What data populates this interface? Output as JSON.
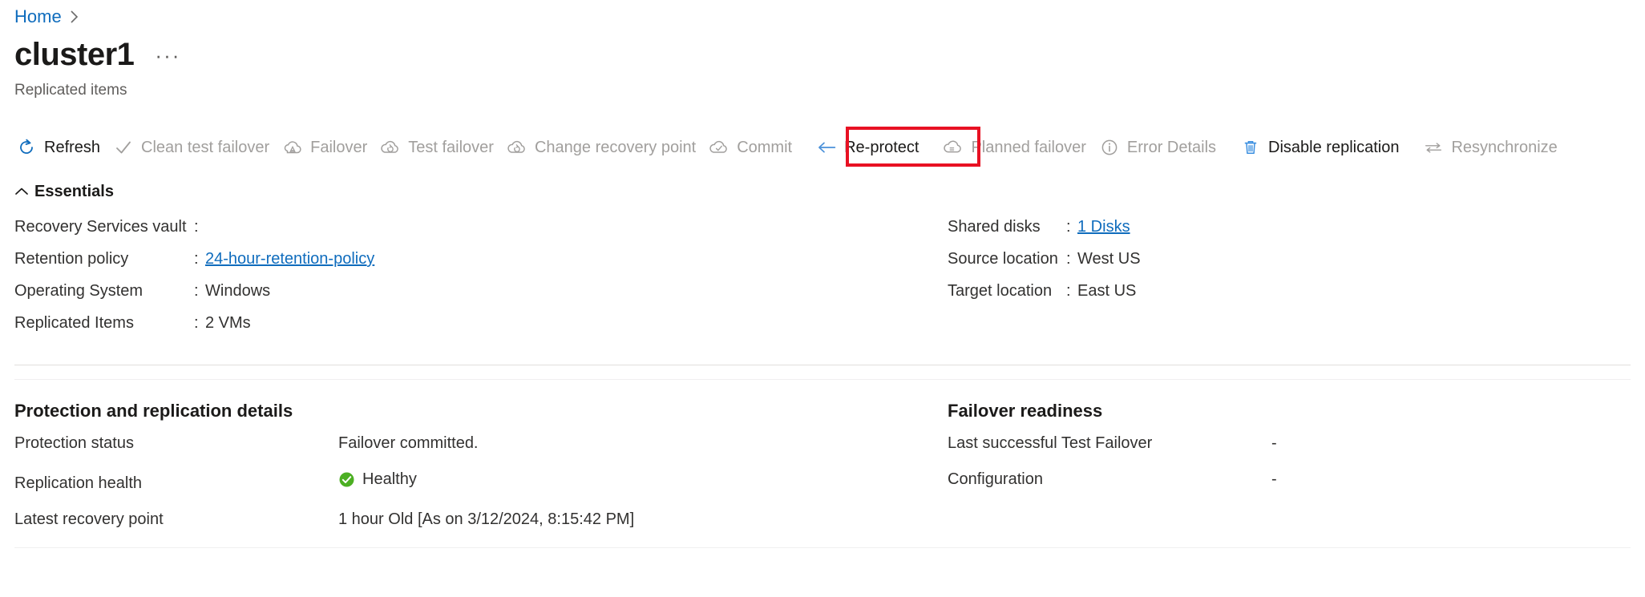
{
  "breadcrumb": {
    "home_label": "Home",
    "separator": "›"
  },
  "header": {
    "title": "cluster1",
    "ellipsis_label": "···",
    "subtitle": "Replicated items"
  },
  "colors": {
    "accent": "#0f6cbd",
    "highlight_box": "#e81123",
    "healthy_green": "#4caf23",
    "disabled_text": "#a19f9d",
    "text": "#323130"
  },
  "commandbar": {
    "items": [
      {
        "label": "Refresh",
        "icon": "refresh-icon",
        "enabled": true,
        "highlighted": false
      },
      {
        "label": "Clean test failover",
        "icon": "checkmark-icon",
        "enabled": false,
        "highlighted": false
      },
      {
        "label": "Failover",
        "icon": "cloud-failover-icon",
        "enabled": false,
        "highlighted": false
      },
      {
        "label": "Test failover",
        "icon": "cloud-test-failover-icon",
        "enabled": false,
        "highlighted": false
      },
      {
        "label": "Change recovery point",
        "icon": "cloud-recovery-point-icon",
        "enabled": false,
        "highlighted": false
      },
      {
        "label": "Commit",
        "icon": "cloud-commit-icon",
        "enabled": false,
        "highlighted": false
      },
      {
        "label": "Re-protect",
        "icon": "arrow-left-icon",
        "enabled": true,
        "highlighted": true
      },
      {
        "label": "Planned failover",
        "icon": "cloud-planned-failover-icon",
        "enabled": false,
        "highlighted": false
      },
      {
        "label": "Error Details",
        "icon": "info-icon",
        "enabled": false,
        "highlighted": false
      },
      {
        "label": "Disable replication",
        "icon": "trash-icon",
        "enabled": true,
        "highlighted": false
      },
      {
        "label": "Resynchronize",
        "icon": "resynchronize-icon",
        "enabled": false,
        "highlighted": false
      }
    ]
  },
  "essentials": {
    "header_label": "Essentials",
    "left": [
      {
        "label": "Recovery Services vault",
        "value": "",
        "link": false
      },
      {
        "label": "Retention policy",
        "value": "24-hour-retention-policy",
        "link": true
      },
      {
        "label": "Operating System",
        "value": "Windows",
        "link": false
      },
      {
        "label": "Replicated Items",
        "value": "2 VMs",
        "link": false
      }
    ],
    "right": [
      {
        "label": "Shared disks",
        "value": "1 Disks",
        "link": true
      },
      {
        "label": "Source location",
        "value": "West US",
        "link": false
      },
      {
        "label": "Target location",
        "value": "East US",
        "link": false
      }
    ],
    "colon": ":"
  },
  "protection": {
    "section_title": "Protection and replication details",
    "rows": [
      {
        "label": "Protection status",
        "value": "Failover committed.",
        "icon": null
      },
      {
        "label": "Replication health",
        "value": "Healthy",
        "icon": "healthy-check-icon"
      },
      {
        "label": "Latest recovery point",
        "value": "1 hour Old [As on 3/12/2024, 8:15:42 PM]",
        "icon": null
      }
    ]
  },
  "failover_readiness": {
    "section_title": "Failover readiness",
    "rows": [
      {
        "label": "Last successful Test Failover",
        "value": "-"
      },
      {
        "label": "Configuration",
        "value": "-"
      }
    ]
  }
}
